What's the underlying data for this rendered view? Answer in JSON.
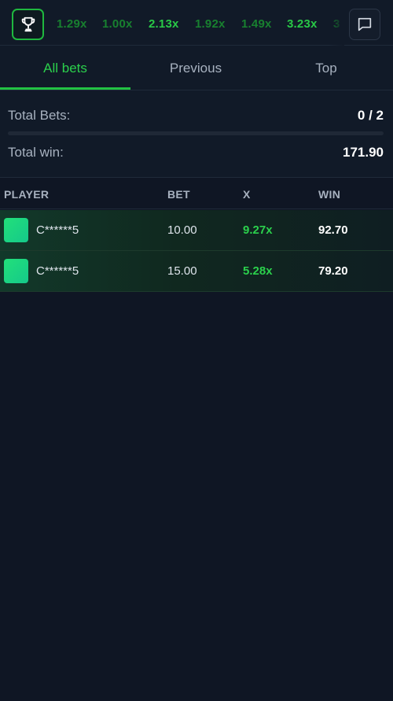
{
  "topbar": {
    "multipliers": [
      {
        "value": "1.29x",
        "style": "dim"
      },
      {
        "value": "1.00x",
        "style": "dim"
      },
      {
        "value": "2.13x",
        "style": "hi"
      },
      {
        "value": "1.92x",
        "style": "dim"
      },
      {
        "value": "1.49x",
        "style": "dim"
      },
      {
        "value": "3.23x",
        "style": "hi"
      },
      {
        "value": "3",
        "style": "dim"
      }
    ],
    "trophy_icon": "trophy-icon",
    "chat_icon": "chat-icon"
  },
  "tabs": [
    {
      "label": "All bets",
      "active": true
    },
    {
      "label": "Previous",
      "active": false
    },
    {
      "label": "Top",
      "active": false
    }
  ],
  "totals": {
    "total_bets_label": "Total Bets:",
    "total_bets_value": "0 / 2",
    "progress_fraction": 0,
    "total_win_label": "Total win:",
    "total_win_value": "171.90"
  },
  "table": {
    "headers": {
      "player": "PLAYER",
      "bet": "BET",
      "x": "X",
      "win": "WIN"
    },
    "rows": [
      {
        "player": "C******5",
        "bet": "10.00",
        "x": "9.27x",
        "win": "92.70"
      },
      {
        "player": "C******5",
        "bet": "15.00",
        "x": "5.28x",
        "win": "79.20"
      }
    ]
  },
  "colors": {
    "accent": "#22c243",
    "background": "#0f1624",
    "panel": "#111a28",
    "row_highlight": "#12392a",
    "avatar": "#22e07a"
  }
}
